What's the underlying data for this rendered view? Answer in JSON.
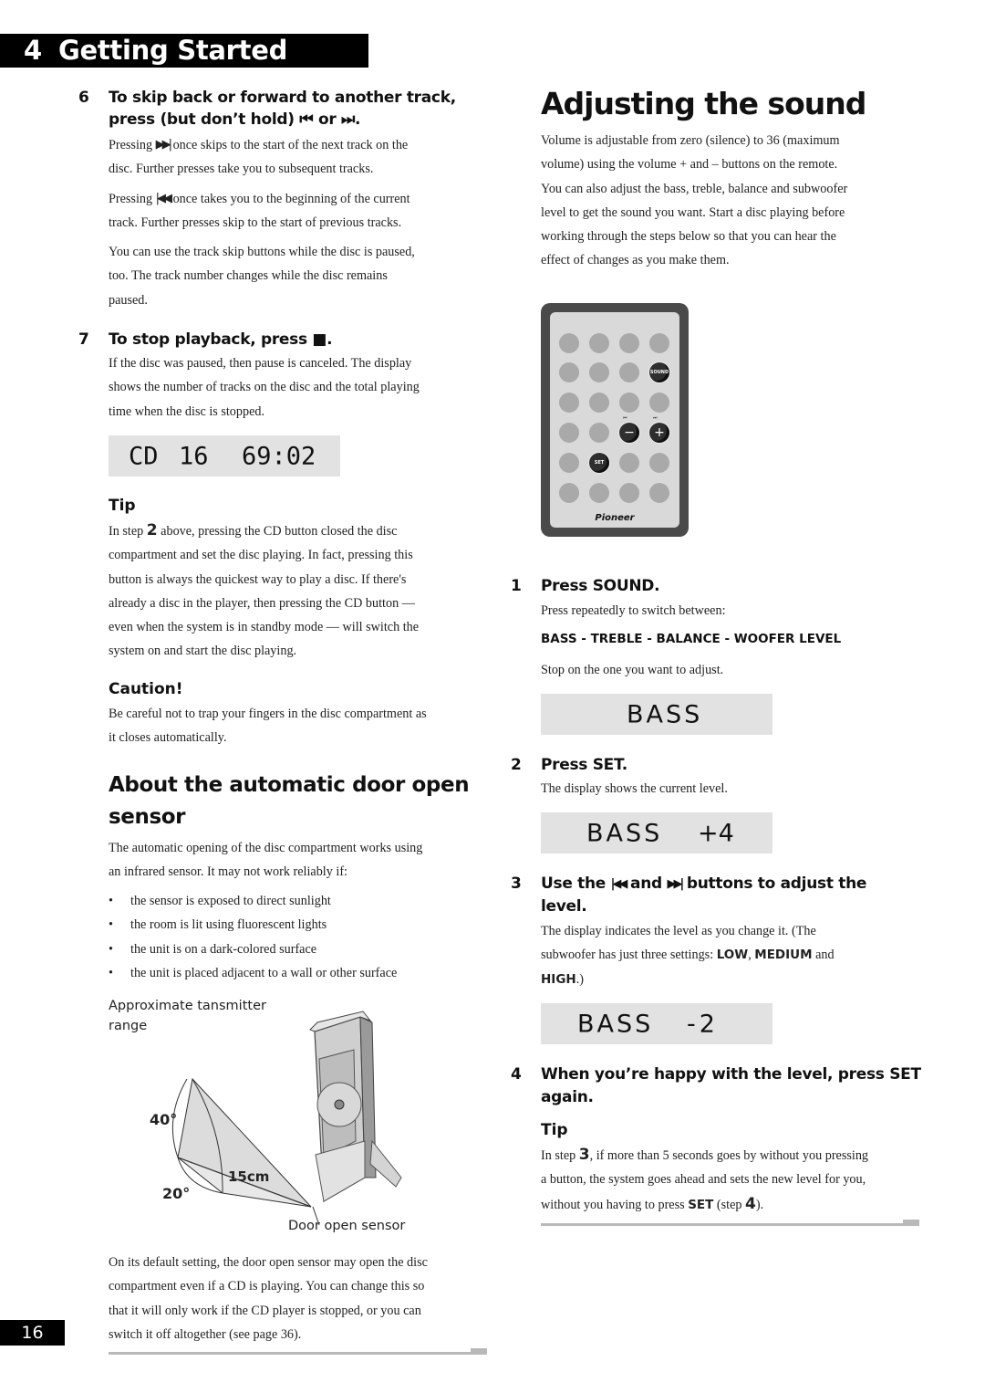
{
  "header": {
    "chapter_number": "4",
    "chapter_title": "Getting Started"
  },
  "page_number": "16",
  "left": {
    "step6": {
      "number": "6",
      "title_line1": "To skip back or forward to another track,",
      "title_line2": "press (but don’t hold) ⏮ or ⏭.",
      "p1_line1_pre": "Pressing ",
      "p1_line1_post": " once skips to the start of the next track on the",
      "p1_line2": "disc. Further presses take you to subsequent tracks.",
      "p2_line1_pre": "Pressing ",
      "p2_line1_post": " once takes you to the beginning of the current",
      "p2_line2": "track. Further presses skip to the start of previous tracks.",
      "p3_lines": [
        "You can use the track skip buttons while the disc is paused,",
        "too. The track number changes while the disc remains",
        "paused."
      ]
    },
    "step7": {
      "number": "7",
      "title": "To stop playback, press ■.",
      "lines": [
        "If the disc was paused, then pause is canceled. The display",
        "shows the number of tracks on the disc and the total playing",
        "time when the disc is stopped."
      ],
      "display": {
        "source": "CD",
        "tracks": "16",
        "time": "69:02"
      }
    },
    "tip": {
      "heading": "Tip",
      "line1_pre": "In step ",
      "line1_step": "2",
      "line1_post": " above, pressing the CD button closed the disc",
      "lines": [
        "compartment and set the disc playing. In fact, pressing this",
        "button is always the quickest way to play a disc. If there's",
        "already a disc in the player, then pressing the CD button —",
        "even when the system is in standby mode — will switch the",
        "system on and start the disc playing."
      ]
    },
    "caution": {
      "heading": "Caution!",
      "lines": [
        "Be careful not to trap your fingers in the disc compartment as",
        "it closes automatically."
      ]
    },
    "door_sensor": {
      "heading_line1": "About the automatic door open",
      "heading_line2": "sensor",
      "intro_lines": [
        "The automatic opening of the disc compartment works using",
        "an infrared sensor. It may not work reliably if:"
      ],
      "bullets": [
        "the sensor is exposed to direct sunlight",
        "the room is lit using fluorescent lights",
        "the unit is on a dark-colored surface",
        "the unit is placed adjacent to a wall or other surface"
      ],
      "figure": {
        "caption_line1": "Approximate tansmitter",
        "caption_line2": "range",
        "angle_upper": "40°",
        "angle_lower": "20°",
        "distance": "15cm",
        "sensor_label": "Door open sensor"
      },
      "outro_lines": [
        "On its default setting, the door open sensor may open the disc",
        "compartment even if a CD is playing. You can change this so",
        "that it will only work if the CD player is stopped, or you can",
        "switch it off altogether (see page 36)."
      ]
    }
  },
  "right": {
    "title": "Adjusting the sound",
    "intro_lines": [
      "Volume is adjustable from zero (silence) to 36 (maximum",
      "volume) using the volume  +  and –  buttons on the remote.",
      "You can also adjust the bass, treble, balance and subwoofer",
      "level to get the sound you want. Start a disc playing before",
      "working through the steps below so that you can hear the",
      "effect of changes as you make them."
    ],
    "remote": {
      "brand": "Pioneer",
      "sound_label": "SOUND",
      "set_label": "SET",
      "minus_label": "−",
      "plus_label": "+",
      "prev_label": "⏮",
      "next_label": "⏭"
    },
    "step1": {
      "number": "1",
      "title": "Press SOUND.",
      "line1": "Press repeatedly to switch between:",
      "sequence": "BASS - TREBLE - BALANCE - WOOFER LEVEL",
      "line2": "Stop on the one you want to adjust.",
      "display": "BASS"
    },
    "step2": {
      "number": "2",
      "title": "Press SET.",
      "line1": "The display shows the current level.",
      "display_label": "BASS",
      "display_value": "+4"
    },
    "step3": {
      "number": "3",
      "title_pre": "Use the ",
      "title_mid": " and ",
      "title_post": " buttons to adjust the",
      "title_line2": "level.",
      "line1": "The display indicates the level as you change it. (The",
      "line2_pre": "subwoofer has just three settings: ",
      "low": "LOW",
      "comma": ", ",
      "medium": "MEDIUM",
      "and": " and",
      "high": "HIGH",
      "line3_post": ".)",
      "display_label": "BASS",
      "display_value": "-2"
    },
    "step4": {
      "number": "4",
      "title_line1": "When you’re happy with the level, press SET",
      "title_line2": "again.",
      "tip_heading": "Tip",
      "tip_line1_pre": "In step ",
      "tip_line1_step": "3",
      "tip_line1_post": ", if more than 5 seconds goes by without you pressing",
      "tip_line2": "a button, the system goes ahead and sets the new level for you,",
      "tip_line3_pre": "without you having to press ",
      "tip_set": "SET",
      "tip_line3_mid": " (step ",
      "tip_line3_step": "4",
      "tip_line3_post": ")."
    }
  }
}
